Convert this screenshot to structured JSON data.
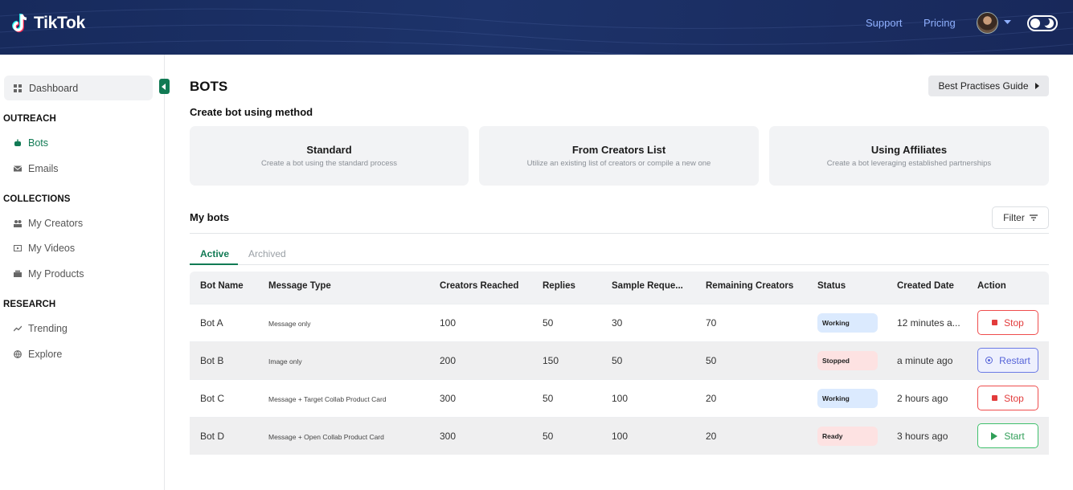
{
  "header": {
    "app_name": "TikTok",
    "links": [
      "Support",
      "Pricing"
    ],
    "avatar_icon": "user-avatar",
    "theme_toggle_icon": "moon-icon"
  },
  "sidebar": {
    "dashboard": "Dashboard",
    "sections": [
      {
        "title": "OUTREACH",
        "items": [
          {
            "label": "Bots",
            "icon": "robot-icon",
            "active": true
          },
          {
            "label": "Emails",
            "icon": "mail-icon"
          }
        ]
      },
      {
        "title": "COLLECTIONS",
        "items": [
          {
            "label": "My Creators",
            "icon": "people-icon"
          },
          {
            "label": "My Videos",
            "icon": "video-icon"
          },
          {
            "label": "My Products",
            "icon": "box-icon"
          }
        ]
      },
      {
        "title": "RESEARCH",
        "items": [
          {
            "label": "Trending",
            "icon": "trend-icon"
          },
          {
            "label": "Explore",
            "icon": "globe-icon"
          }
        ]
      }
    ]
  },
  "main": {
    "title": "BOTS",
    "guide_button": "Best Practises Guide",
    "create_label": "Create bot using method",
    "methods": [
      {
        "title": "Standard",
        "desc": "Create a bot using the standard process"
      },
      {
        "title": "From Creators List",
        "desc": "Utilize an existing list of creators or compile a new one"
      },
      {
        "title": "Using Affiliates",
        "desc": "Create a bot leveraging established partnerships"
      }
    ],
    "my_bots": "My bots",
    "filter": "Filter",
    "tabs": [
      "Active",
      "Archived"
    ],
    "columns": [
      "Bot Name",
      "Message Type",
      "Creators Reached",
      "Replies",
      "Sample Reque...",
      "Remaining Creators",
      "Status",
      "Created Date",
      "Action"
    ],
    "rows": [
      {
        "name": "Bot A",
        "type": "Message only",
        "reached": "100",
        "replies": "50",
        "samples": "30",
        "remaining": "70",
        "status": "Working",
        "created": "12 minutes a...",
        "action": "Stop"
      },
      {
        "name": "Bot B",
        "type": "Image only",
        "reached": "200",
        "replies": "150",
        "samples": "50",
        "remaining": "50",
        "status": "Stopped",
        "created": "a minute ago",
        "action": "Restart"
      },
      {
        "name": "Bot C",
        "type": "Message + Target Collab Product Card",
        "reached": "300",
        "replies": "50",
        "samples": "100",
        "remaining": "20",
        "status": "Working",
        "created": "2 hours ago",
        "action": "Stop"
      },
      {
        "name": "Bot D",
        "type": "Message + Open Collab Product Card",
        "reached": "300",
        "replies": "50",
        "samples": "100",
        "remaining": "20",
        "status": "Ready",
        "created": "3 hours ago",
        "action": "Start"
      }
    ]
  },
  "colors": {
    "accent": "#117a54",
    "header": "#1d336a",
    "stop": "#e23b3b",
    "restart": "#5563d8",
    "start": "#2f9e57"
  }
}
